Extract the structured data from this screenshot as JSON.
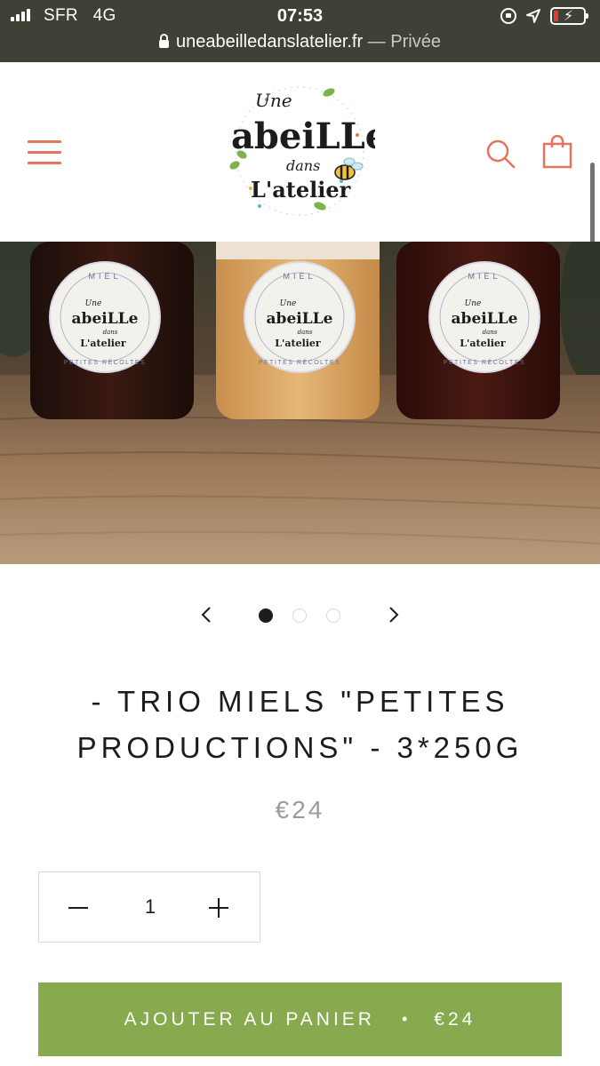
{
  "status_bar": {
    "carrier": "SFR",
    "network": "4G",
    "time": "07:53",
    "url_domain": "uneabeilledanslatelier.fr",
    "url_separator": " — ",
    "url_mode": "Privée"
  },
  "header": {
    "logo_lines": [
      "Une",
      "abeiLLe",
      "dans",
      "L'atelier"
    ],
    "icons": [
      "hamburger-menu-icon",
      "search-icon",
      "shopping-bag-icon"
    ],
    "accent_color": "#e5735d"
  },
  "product_image": {
    "label_top": "MIEL",
    "label_bottom": "PETITES RÉCOLTES",
    "label_brand": [
      "Une",
      "abeiLLe",
      "dans",
      "L'atelier"
    ]
  },
  "carousel": {
    "current": 1,
    "total": 3
  },
  "product": {
    "title": "- TRIO MIELS \"PETITES PRODUCTIONS\" - 3*250G",
    "price": "€24",
    "quantity": "1",
    "add_to_cart_label": "AJOUTER AU PANIER",
    "add_to_cart_separator": "•",
    "add_to_cart_price": "€24",
    "button_color": "#86aa4d"
  }
}
